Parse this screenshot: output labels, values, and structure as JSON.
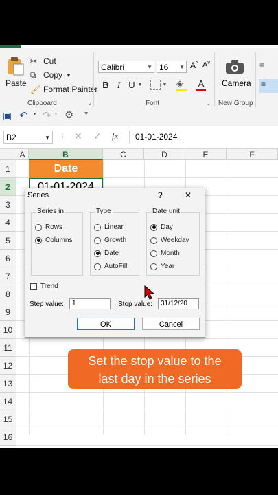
{
  "ribbon": {
    "paste": "Paste",
    "cut": "Cut",
    "copy": "Copy",
    "format_painter": "Format Painter",
    "clipboard_group": "Clipboard",
    "font_name": "Calibri",
    "font_size": "16",
    "bold": "B",
    "italic": "I",
    "underline": "U",
    "font_group": "Font",
    "camera": "Camera",
    "new_group": "New Group"
  },
  "formula_bar": {
    "name_box": "B2",
    "fx": "fx",
    "value": "01-01-2024"
  },
  "sheet": {
    "columns": [
      "A",
      "B",
      "C",
      "D",
      "E",
      "F"
    ],
    "rows": [
      "1",
      "2",
      "3",
      "4",
      "5",
      "6",
      "7",
      "8",
      "9",
      "10",
      "11",
      "12",
      "13",
      "14",
      "15",
      "16"
    ],
    "b1": "Date",
    "b2": "01-01-2024"
  },
  "dialog": {
    "title": "Series",
    "help": "?",
    "close": "✕",
    "series_in": {
      "label": "Series in",
      "options": [
        "Rows",
        "Columns"
      ],
      "selected": "Columns"
    },
    "type": {
      "label": "Type",
      "options": [
        "Linear",
        "Growth",
        "Date",
        "AutoFill"
      ],
      "selected": "Date"
    },
    "date_unit": {
      "label": "Date unit",
      "options": [
        "Day",
        "Weekday",
        "Month",
        "Year"
      ],
      "selected": "Day"
    },
    "trend": "Trend",
    "step_label": "Step value:",
    "step_value": "1",
    "stop_label": "Stop value:",
    "stop_value": "31/12/20",
    "ok": "OK",
    "cancel": "Cancel"
  },
  "caption": {
    "line1": "Set the stop value to the",
    "line2": "last day in the series"
  },
  "colors": {
    "accent": "#f28a2e",
    "caption": "#f06a26",
    "excel_green": "#1e7145"
  }
}
